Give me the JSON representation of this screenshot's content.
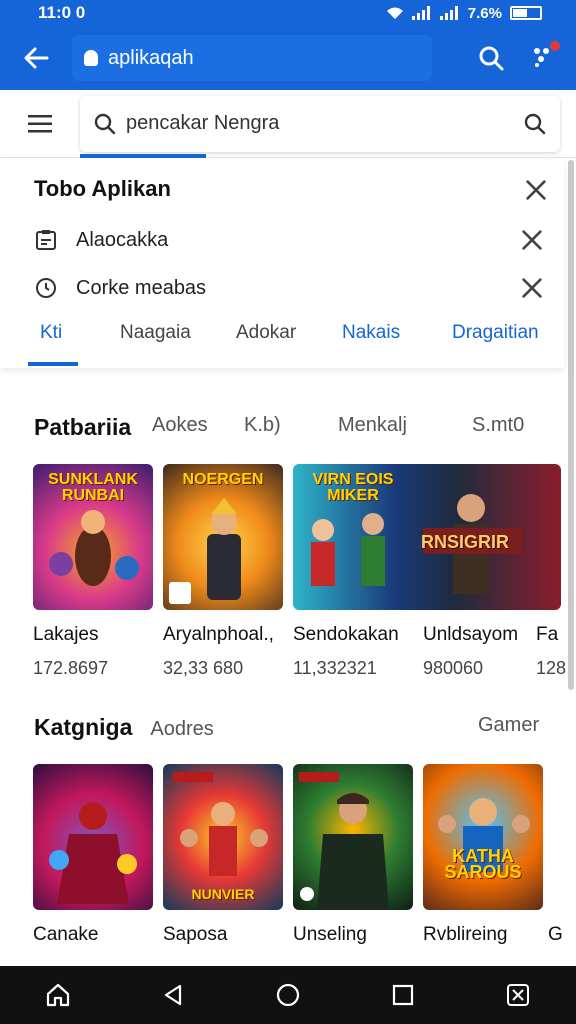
{
  "status_bar": {
    "time": "11:0 0",
    "battery": "7.6%"
  },
  "top_bar": {
    "url": "aplikaqah"
  },
  "search": {
    "value": "pencakar Nengra"
  },
  "suggestions": {
    "title": "Tobo Aplikan",
    "items": [
      {
        "label": "Alaocakka",
        "icon": "clipboard-icon"
      },
      {
        "label": "Corke meabas",
        "icon": "history-icon"
      }
    ]
  },
  "tabs": [
    {
      "label": "Kti",
      "active": true
    },
    {
      "label": "Naagaia"
    },
    {
      "label": "Adokar"
    },
    {
      "label": "Nakais"
    },
    {
      "label": "Dragaitian"
    }
  ],
  "section1": {
    "title": "Patbariia",
    "filters": [
      "Aokes",
      "K.b)",
      "Menkalj",
      "S.mt0"
    ],
    "cards": [
      {
        "name": "Lakajes",
        "stat": "172.8697",
        "art": "SUNKLANK RUNBAI",
        "colors": [
          "#3b1d6e",
          "#d93a8a",
          "#f5a623"
        ]
      },
      {
        "name": "Aryalnphoal.,",
        "stat": "32,33 680",
        "art": "NOERGEN",
        "colors": [
          "#3c2a1c",
          "#f08a1a",
          "#ffd54a"
        ]
      },
      {
        "name": "Sendokakan",
        "stat": "11,332321",
        "art": "VIRN EOIS MIKER",
        "colors": [
          "#1a3a7a",
          "#2fb3c9",
          "#ff6a3d"
        ]
      },
      {
        "name": "Unldsayom",
        "stat": "980060",
        "art": "RNSIGRIR",
        "colors": [
          "#1d2b3f",
          "#8b1d2a",
          "#e0a84a"
        ]
      },
      {
        "name": "Fa",
        "stat": "128"
      }
    ]
  },
  "section2": {
    "title": "Katgniga",
    "filter": "Aodres",
    "right_label": "Gamer",
    "cards": [
      {
        "name": "Canake",
        "art": "",
        "colors": [
          "#2a0f3e",
          "#c2185b",
          "#7e57c2"
        ]
      },
      {
        "name": "Saposa",
        "art": "NUNVIER",
        "colors": [
          "#103a5c",
          "#e53935",
          "#ffca28"
        ]
      },
      {
        "name": "Unseling",
        "art": "",
        "colors": [
          "#0f1f16",
          "#2e7d32",
          "#ffb300"
        ]
      },
      {
        "name": "Rvblireing",
        "art": "KATHA SAROUS",
        "colors": [
          "#5b2b1a",
          "#ef6c00",
          "#4fc3f7"
        ]
      },
      {
        "name": "G"
      }
    ]
  }
}
